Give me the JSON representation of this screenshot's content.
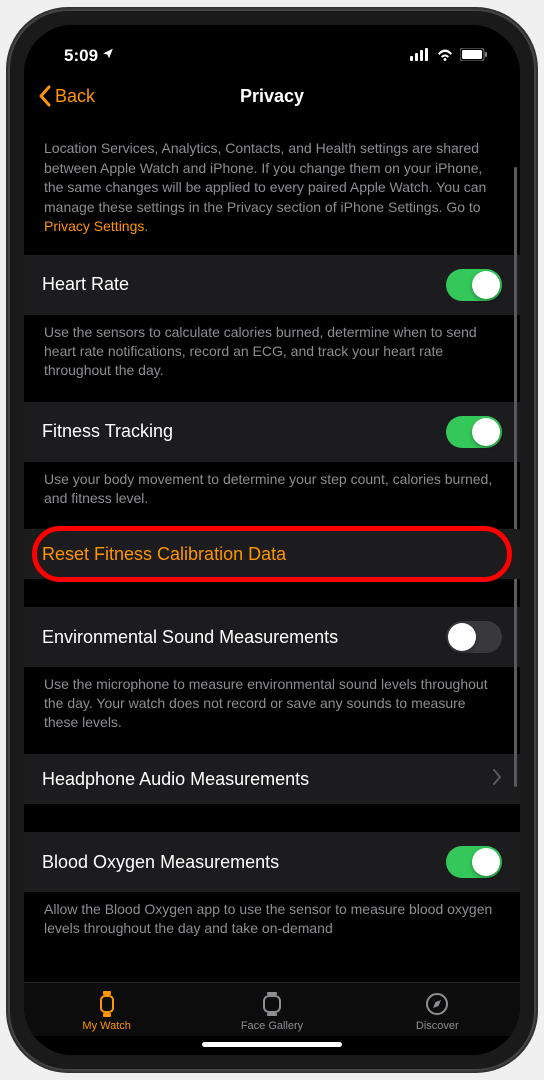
{
  "status_bar": {
    "time": "5:09",
    "location_indicator": "↗"
  },
  "nav": {
    "back_label": "Back",
    "title": "Privacy"
  },
  "intro": {
    "text": "Location Services, Analytics, Contacts, and Health settings are shared between Apple Watch and iPhone. If you change them on your iPhone, the same changes will be applied to every paired Apple Watch. You can manage these settings in the Privacy section of iPhone Settings. Go to ",
    "link": "Privacy Settings"
  },
  "settings": {
    "heart_rate": {
      "label": "Heart Rate",
      "desc": "Use the sensors to calculate calories burned, determine when to send heart rate notifications, record an ECG, and track your heart rate throughout the day.",
      "enabled": true
    },
    "fitness_tracking": {
      "label": "Fitness Tracking",
      "desc": "Use your body movement to determine your step count, calories burned, and fitness level.",
      "enabled": true
    },
    "reset_calibration": {
      "label": "Reset Fitness Calibration Data"
    },
    "env_sound": {
      "label": "Environmental Sound Measurements",
      "desc": "Use the microphone to measure environmental sound levels throughout the day. Your watch does not record or save any sounds to measure these levels.",
      "enabled": false
    },
    "headphone_audio": {
      "label": "Headphone Audio Measurements"
    },
    "blood_oxygen": {
      "label": "Blood Oxygen Measurements",
      "desc": "Allow the Blood Oxygen app to use the sensor to measure blood oxygen levels throughout the day and take on-demand",
      "enabled": true
    }
  },
  "tabs": {
    "my_watch": "My Watch",
    "face_gallery": "Face Gallery",
    "discover": "Discover"
  }
}
